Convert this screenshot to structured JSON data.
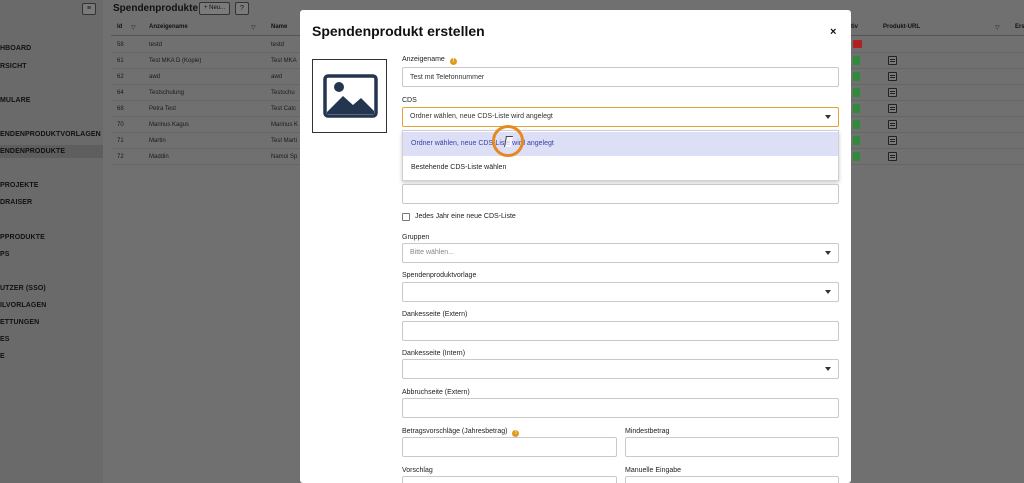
{
  "sidebar": {
    "toggle_icon": "menu-icon",
    "items": [
      {
        "label": "HBOARD"
      },
      {
        "label": "RSICHT"
      },
      {
        "label": "MULARE"
      },
      {
        "label": "ENDENPRODUKTVORLAGEN"
      },
      {
        "label": "ENDENPRODUKTE"
      },
      {
        "label": "PROJEKTE"
      },
      {
        "label": "DRAISER"
      },
      {
        "label": "PPRODUKTE"
      },
      {
        "label": "PS"
      },
      {
        "label": "UTZER (SSO)"
      },
      {
        "label": "ILVORLAGEN"
      },
      {
        "label": "ETTUNGEN"
      },
      {
        "label": "ES"
      },
      {
        "label": "E"
      }
    ]
  },
  "main": {
    "title": "Spendenprodukte",
    "new_label": "+ Neu...",
    "help_label": "?",
    "columns": {
      "id": "Id",
      "anzeigename": "Anzeigename",
      "name": "Name",
      "aktiv": "tiv",
      "url": "Produkt-URL",
      "last": "Ers"
    },
    "rows": [
      {
        "id": "58",
        "anzeigename": "testd",
        "name": "testd"
      },
      {
        "id": "61",
        "anzeigename": "Test MKA D (Kopie)",
        "name": "Test MKA"
      },
      {
        "id": "62",
        "anzeigename": "awd",
        "name": "awd"
      },
      {
        "id": "64",
        "anzeigename": "Testschulung",
        "name": "Testschu"
      },
      {
        "id": "68",
        "anzeigename": "Petra Test",
        "name": "Test Catc"
      },
      {
        "id": "70",
        "anzeigename": "Marinus Kagus",
        "name": "Marinus K"
      },
      {
        "id": "71",
        "anzeigename": "Martin",
        "name": "Test Marti"
      },
      {
        "id": "72",
        "anzeigename": "Maddin",
        "name": "Namoi Sp"
      }
    ]
  },
  "modal": {
    "title": "Spendenprodukt erstellen",
    "close": "×",
    "anzeigename_label": "Anzeigename",
    "anzeigename_value": "Test mit Telefonnummer",
    "cds_label": "CDS",
    "cds_value": "Ordner wählen, neue CDS-Liste wird angelegt",
    "cds_options": [
      "Ordner wählen, neue CDS-Liste wird angelegt",
      "Bestehende CDS-Liste wählen"
    ],
    "checkbox_label": "Jedes Jahr eine neue CDS-Liste",
    "gruppen_label": "Gruppen",
    "gruppen_placeholder": "Bitte wählen...",
    "vorlage_label": "Spendenproduktvorlage",
    "dank_extern_label": "Dankesseite (Extern)",
    "dank_intern_label": "Dankesseite (Intern)",
    "abbruch_label": "Abbruchseite (Extern)",
    "betrag_label": "Betragsvorschläge (Jahresbetrag)",
    "mindest_label": "Mindestbetrag",
    "vorschlag_label": "Vorschlag",
    "manuell_label": "Manuelle Eingabe",
    "info_icon": "!"
  },
  "colors": {
    "accent": "#e09a1a",
    "selected_bg": "#dcdff5",
    "selected_text": "#3a3fa6",
    "active_badge": "#2f8a3a"
  }
}
